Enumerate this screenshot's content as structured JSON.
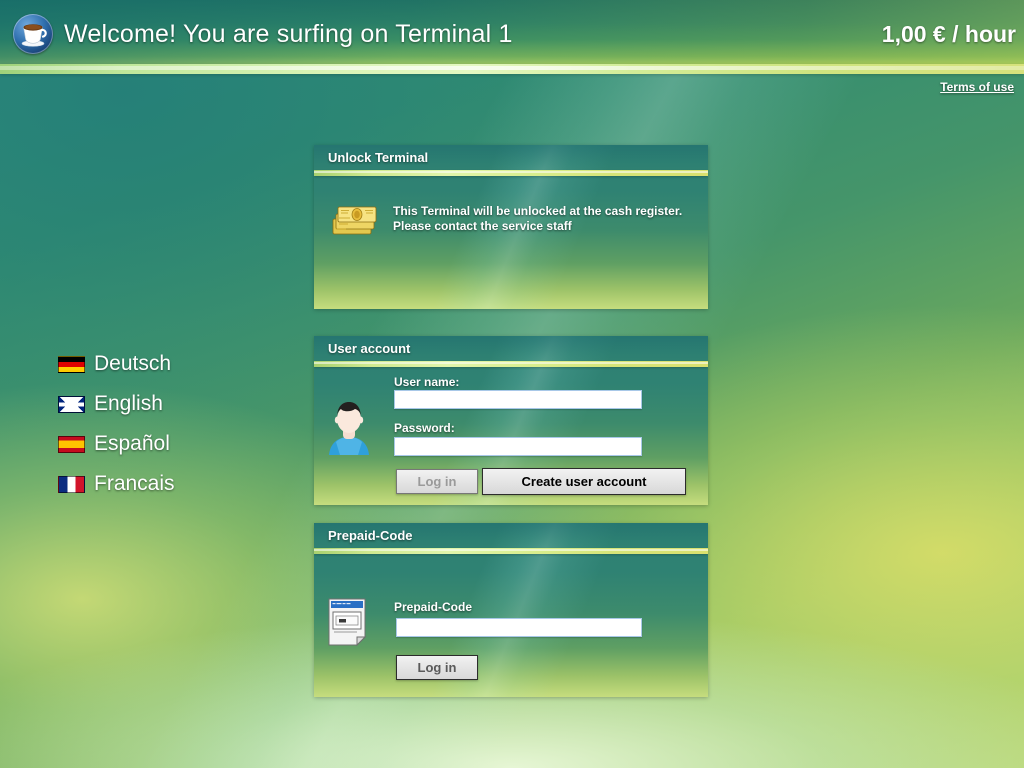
{
  "header": {
    "logo_icon": "coffee-cup-icon",
    "title": "Welcome! You are surfing on Terminal 1",
    "price": "1,00 € / hour",
    "terms_link": "Terms of use"
  },
  "languages": [
    {
      "label": "Deutsch",
      "flag": "flag-de",
      "flag_icon": "german-flag-icon"
    },
    {
      "label": "English",
      "flag": "flag-gb",
      "flag_icon": "uk-flag-icon"
    },
    {
      "label": "Español",
      "flag": "flag-es",
      "flag_icon": "spanish-flag-icon"
    },
    {
      "label": "Francais",
      "flag": "flag-fr",
      "flag_icon": "french-flag-icon"
    }
  ],
  "unlock_panel": {
    "title": "Unlock Terminal",
    "icon": "banknotes-money-icon",
    "message": "This Terminal will be unlocked at the cash register.\nPlease contact the service staff"
  },
  "user_panel": {
    "title": "User account",
    "icon": "user-avatar-icon",
    "username_label": "User name:",
    "username_value": "",
    "username_placeholder": "",
    "password_label": "Password:",
    "password_value": "",
    "password_placeholder": "",
    "login_button": "Log in",
    "login_button_enabled": false,
    "create_account_button": "Create user account"
  },
  "prepaid_panel": {
    "title": "Prepaid-Code",
    "icon": "prepaid-card-icon",
    "code_label": "Prepaid-Code",
    "code_value": "",
    "code_placeholder": "",
    "login_button": "Log in"
  },
  "colors": {
    "header_accent": "#e4f8c2",
    "background_green": "#2f8571",
    "panel_top": "#2e7f74",
    "panel_bottom": "#c6dd7e",
    "input_border": "#a8c8e8",
    "text_white": "#ffffff"
  }
}
